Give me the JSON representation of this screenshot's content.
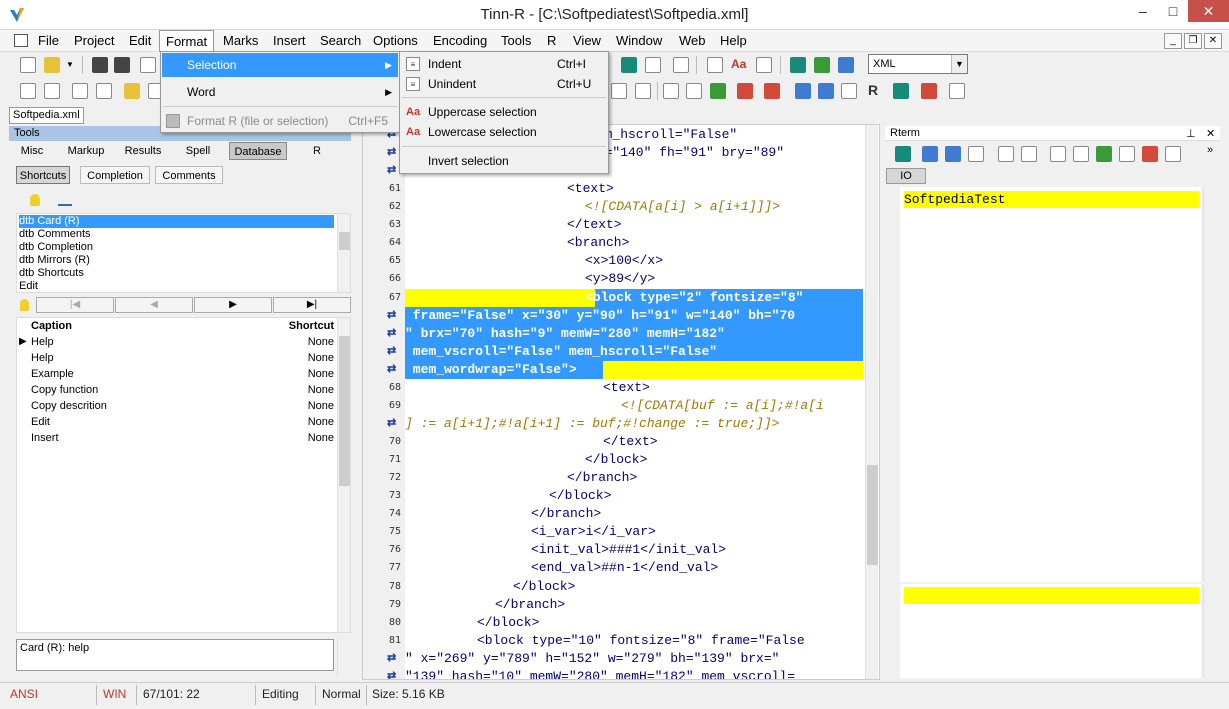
{
  "window": {
    "title": "Tinn-R - [C:\\Softpediatest\\Softpedia.xml]",
    "min": "–",
    "max": "□",
    "close": "✕"
  },
  "menubar": [
    "File",
    "Project",
    "Edit",
    "Format",
    "Marks",
    "Insert",
    "Search",
    "Options",
    "Encoding",
    "Tools",
    "R",
    "View",
    "Window",
    "Web",
    "Help"
  ],
  "format_menu": {
    "items": [
      {
        "label": "Selection",
        "shortcut": "",
        "submenu": true
      },
      {
        "label": "Word",
        "shortcut": "",
        "submenu": true
      },
      {
        "label": "Format R (file or selection)",
        "shortcut": "Ctrl+F5",
        "disabled": true
      }
    ]
  },
  "selection_menu": {
    "items": [
      {
        "label": "Indent",
        "shortcut": "Ctrl+I"
      },
      {
        "label": "Unindent",
        "shortcut": "Ctrl+U"
      },
      {
        "label": "Uppercase selection",
        "shortcut": ""
      },
      {
        "label": "Lowercase selection",
        "shortcut": ""
      },
      {
        "label": "Invert selection",
        "shortcut": ""
      }
    ]
  },
  "syntax_select": "XML",
  "document_tab": "Softpedia.xml",
  "tools": {
    "title": "Tools",
    "tabs": [
      "Misc",
      "Markup",
      "Results",
      "Spell",
      "Database",
      "R"
    ],
    "active_tab": "Database",
    "subtabs": [
      "Shortcuts",
      "Completion",
      "Comments"
    ],
    "active_subtab": "Shortcuts",
    "dbt_items": [
      "dtb Card (R)",
      "dtb Comments",
      "dtb Completion",
      "dtb Mirrors (R)",
      "dtb Shortcuts",
      "Edit"
    ],
    "grid_headers": {
      "caption": "Caption",
      "shortcut": "Shortcut"
    },
    "grid_rows": [
      {
        "caption": "Help",
        "shortcut": "None"
      },
      {
        "caption": "Help",
        "shortcut": "None"
      },
      {
        "caption": "Example",
        "shortcut": "None"
      },
      {
        "caption": "Copy function",
        "shortcut": "None"
      },
      {
        "caption": "Copy descrition",
        "shortcut": "None"
      },
      {
        "caption": "Edit",
        "shortcut": "None"
      },
      {
        "caption": "Insert",
        "shortcut": "None"
      }
    ],
    "card_text": "Card (R): help"
  },
  "editor": {
    "lines": [
      {
        "n": "",
        "wrap": true,
        "text": "mem_hscroll=\"False\""
      },
      {
        "n": "",
        "wrap": true,
        "text": "fw=\"140\" fh=\"91\" bry=\"89\""
      },
      {
        "n": "",
        "wrap": true,
        "text": ""
      },
      {
        "n": "61",
        "text": "<text>"
      },
      {
        "n": "62",
        "text": "<![CDATA[a[i] > a[i+1]]]>"
      },
      {
        "n": "63",
        "text": "</text>"
      },
      {
        "n": "64",
        "text": "<branch>"
      },
      {
        "n": "65",
        "text": "<x>100</x>"
      },
      {
        "n": "66",
        "text": "<y>89</y>"
      },
      {
        "n": "67",
        "text": "<block type=\"2\" fontsize=\"8\""
      },
      {
        "n": "",
        "wrap": true,
        "text": " frame=\"False\" x=\"30\" y=\"90\" h=\"91\" w=\"140\" bh=\"70"
      },
      {
        "n": "",
        "wrap": true,
        "text": "\" brx=\"70\" hash=\"9\" memW=\"280\" memH=\"182\""
      },
      {
        "n": "",
        "wrap": true,
        "text": " mem_vscroll=\"False\" mem_hscroll=\"False\""
      },
      {
        "n": "",
        "wrap": true,
        "text": " mem_wordwrap=\"False\">"
      },
      {
        "n": "68",
        "text": "<text>"
      },
      {
        "n": "69",
        "text": "<![CDATA[buf := a[i];#!a[i"
      },
      {
        "n": "",
        "wrap": true,
        "text": "] := a[i+1];#!a[i+1] := buf;#!change := true;]]>"
      },
      {
        "n": "70",
        "text": "</text>"
      },
      {
        "n": "71",
        "text": "</block>"
      },
      {
        "n": "72",
        "text": "</branch>"
      },
      {
        "n": "73",
        "text": "</block>"
      },
      {
        "n": "74",
        "text": "</branch>"
      },
      {
        "n": "75",
        "text": "<i_var>i</i_var>"
      },
      {
        "n": "76",
        "text": "<init_val>###1</init_val>"
      },
      {
        "n": "77",
        "text": "<end_val>##n-1</end_val>"
      },
      {
        "n": "78",
        "text": "</block>"
      },
      {
        "n": "79",
        "text": "</branch>"
      },
      {
        "n": "80",
        "text": "</block>"
      },
      {
        "n": "81",
        "text": "<block type=\"10\" fontsize=\"8\" frame=\"False"
      },
      {
        "n": "",
        "wrap": true,
        "text": "\" x=\"269\" y=\"789\" h=\"152\" w=\"279\" bh=\"139\" brx=\""
      },
      {
        "n": "",
        "wrap": true,
        "text": "\"139\" hash=\"10\" memW=\"280\" memH=\"182\" mem_vscroll="
      }
    ]
  },
  "rterm": {
    "title": "Rterm",
    "io_tab": "IO",
    "console_text": "SoftpediaTest"
  },
  "status": {
    "encoding": "ANSI",
    "eol": "WIN",
    "position": "67/101: 22",
    "mode": "Editing",
    "view": "Normal",
    "size": "Size: 5.16 KB"
  },
  "colors": {
    "highlight": "#ffff00",
    "selection": "#3399ff",
    "xml_tag": "#000080",
    "cdata": "#a07800"
  }
}
